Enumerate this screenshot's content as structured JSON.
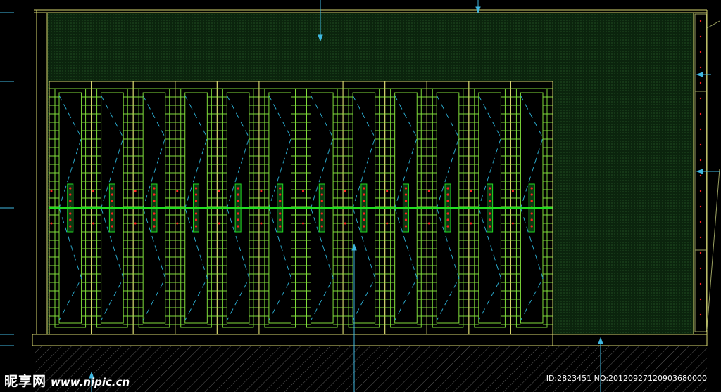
{
  "watermark": {
    "brand": "昵享网",
    "url": "www.nipic.cn",
    "id_label": "ID:2823451 NO:20120927120903680000"
  },
  "drawing": {
    "panel_count": 12,
    "colors": {
      "background": "#000000",
      "frame_yellow": "#d8d870",
      "grid_green": "#7fdc3a",
      "bright_green": "#22dd22",
      "dash_cyan": "#2aa7c9",
      "marker_cyan": "#3fb7e0",
      "hatch_fill": "#0d2a0f",
      "accent_red": "#ff2222",
      "ground_hatch": "#666666"
    }
  }
}
